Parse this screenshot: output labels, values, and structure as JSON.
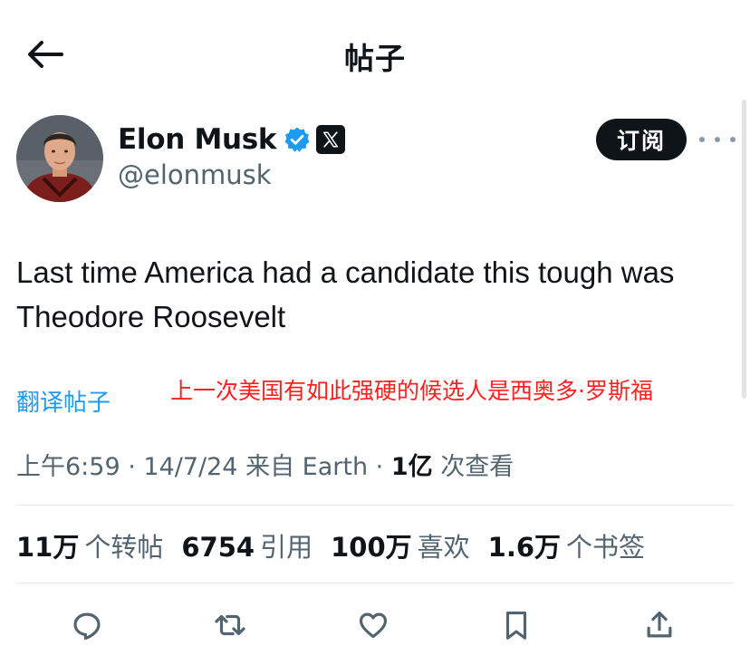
{
  "header": {
    "title": "帖子"
  },
  "author": {
    "name": "Elon Musk",
    "handle": "@elonmusk"
  },
  "subscribe_label": "订阅",
  "tweet": {
    "text": "Last time America had a candidate this tough was Theodore Roosevelt"
  },
  "translate_label": "翻译帖子",
  "annotation": "上一次美国有如此强硬的候选人是西奥多·罗斯福",
  "meta": {
    "time": "上午6:59",
    "sep1": " · ",
    "date": "14/7/24",
    "source": " 来自 Earth",
    "sep2": " · ",
    "views_count": "1亿",
    "views_label": " 次查看"
  },
  "stats": [
    {
      "value": "11万",
      "label": "个转帖"
    },
    {
      "value": "6754",
      "label": "引用"
    },
    {
      "value": "100万",
      "label": "喜欢"
    },
    {
      "value": "1.6万",
      "label": "个书签"
    }
  ],
  "icons": {
    "back": "arrow-left-icon",
    "verified": "verified-badge-icon",
    "affiliate": "x-logo-icon",
    "more": "more-horizontal-icon",
    "reply": "reply-icon",
    "repost": "repost-icon",
    "like": "heart-icon",
    "bookmark": "bookmark-icon",
    "share": "share-icon"
  },
  "colors": {
    "text": "#0f1419",
    "secondary": "#536471",
    "link": "#1d9bf0",
    "verified": "#1d9bf0",
    "annotation": "#ff1f1f",
    "button_bg": "#0f1419"
  }
}
